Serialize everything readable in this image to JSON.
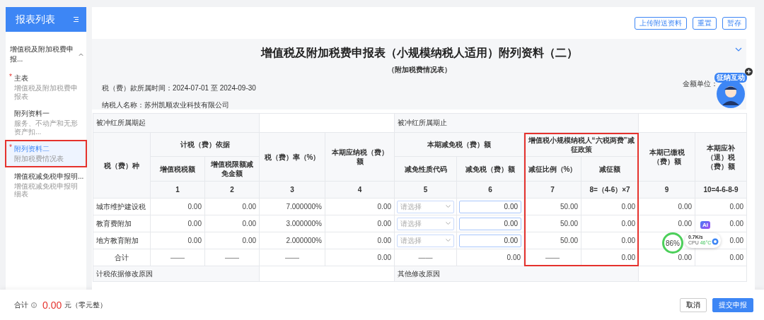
{
  "sidebar": {
    "title": "报表列表",
    "required_mark": "*",
    "group": {
      "label": "增值税及附加税费申报...",
      "expanded": true,
      "items": [
        {
          "title": "主表",
          "subtitle": "增值税及附加税费申报表",
          "required": true,
          "selected": false,
          "outlined": false
        },
        {
          "title": "附列资料一",
          "subtitle": "服务、不动产和无形资产扣...",
          "required": false,
          "selected": false,
          "outlined": false
        },
        {
          "title": "附列资料二",
          "subtitle": "附加税费情况表",
          "required": true,
          "selected": true,
          "outlined": true
        },
        {
          "title": "增值税减免税申报明...",
          "subtitle": "增值税减免税申报明细表",
          "required": false,
          "selected": false,
          "outlined": false
        }
      ]
    }
  },
  "toolbar_buttons": [
    "上传附送资料",
    "重置",
    "暂存"
  ],
  "form": {
    "title": "增值税及附加税费申报表（小规模纳税人适用）附列资料（二）",
    "subtitle": "（附加税费情况表）",
    "period": "税（费）款所属时间：2024-07-01 至 2024-09-30",
    "taxpayer": "纳税人名称：苏州凯顺农业科技有限公司",
    "unit_label": "金额单位：",
    "expanded": true
  },
  "assistant": {
    "label": "征纳互动"
  },
  "table": {
    "period_start": "被冲红所属期起",
    "period_end": "被冲红所属期止",
    "header_row_1": [
      "税（费）种",
      "计税（费）依据",
      "税（费）率（%）",
      "本期应纳税（费）额",
      "本期减免税（费）额",
      "增值税小规模纳税人“六税两费”减征政策",
      "本期已缴税（费）额",
      "本期应补（退）税（费）额"
    ],
    "header_row_2": [
      "增值税税额",
      "增值税限额减免金额",
      "减免性质代码",
      "减免税（费）额",
      "减征比例（%）",
      "减征额"
    ],
    "column_numbers": [
      "1",
      "2",
      "3",
      "4",
      "5",
      "6",
      "7",
      "8=（4-6）×7",
      "9",
      "10=4-6-8-9"
    ],
    "rows": [
      {
        "kind": "data",
        "label": "城市维护建设税",
        "cells": [
          {
            "kind": "text",
            "text": "0.00"
          },
          {
            "kind": "text",
            "text": "0.00"
          },
          {
            "kind": "text",
            "text": "7.000000%"
          },
          {
            "kind": "text",
            "text": "0.00"
          },
          {
            "kind": "select",
            "placeholder": "请选择"
          },
          {
            "kind": "input",
            "value": "0.00"
          },
          {
            "kind": "text",
            "text": "50.00"
          },
          {
            "kind": "text",
            "text": "0.00"
          },
          {
            "kind": "text",
            "text": "0.00"
          },
          {
            "kind": "text",
            "text": "0.00"
          }
        ]
      },
      {
        "kind": "data",
        "label": "教育费附加",
        "cells": [
          {
            "kind": "text",
            "text": "0.00"
          },
          {
            "kind": "text",
            "text": "0.00"
          },
          {
            "kind": "text",
            "text": "3.000000%"
          },
          {
            "kind": "text",
            "text": "0.00"
          },
          {
            "kind": "select",
            "placeholder": "请选择"
          },
          {
            "kind": "input",
            "value": "0.00"
          },
          {
            "kind": "text",
            "text": "50.00"
          },
          {
            "kind": "text",
            "text": "0.00"
          },
          {
            "kind": "text",
            "text": "0.00"
          },
          {
            "kind": "text",
            "text": "0.00"
          }
        ]
      },
      {
        "kind": "data",
        "label": "地方教育附加",
        "cells": [
          {
            "kind": "text",
            "text": "0.00"
          },
          {
            "kind": "text",
            "text": "0.00"
          },
          {
            "kind": "text",
            "text": "2.000000%"
          },
          {
            "kind": "text",
            "text": "0.00"
          },
          {
            "kind": "select",
            "placeholder": "请选择"
          },
          {
            "kind": "input",
            "value": "0.00"
          },
          {
            "kind": "text",
            "text": "50.00"
          },
          {
            "kind": "text",
            "text": "0.00"
          },
          {
            "kind": "blank"
          },
          {
            "kind": "text",
            "text": "0.00"
          }
        ]
      },
      {
        "kind": "total",
        "label": "合计",
        "cells": [
          {
            "kind": "dash",
            "text": "——"
          },
          {
            "kind": "dash",
            "text": "——"
          },
          {
            "kind": "dash",
            "text": "——"
          },
          {
            "kind": "text",
            "text": "0.00"
          },
          {
            "kind": "dash",
            "text": "——"
          },
          {
            "kind": "text",
            "text": "0.00"
          },
          {
            "kind": "dash",
            "text": "——"
          },
          {
            "kind": "text",
            "text": "0.00"
          },
          {
            "kind": "text",
            "text": "0.00"
          },
          {
            "kind": "text",
            "text": "0.00"
          }
        ]
      }
    ],
    "reason_basis": "计税依据修改原因",
    "reason_other": "其他修改原因",
    "policy_outlined": true
  },
  "monitor_widget": {
    "ai_badge": "AI",
    "percent": "86%",
    "speed": "0.7K/s",
    "cpu_label": "CPU",
    "temperature": "46°C"
  },
  "footer": {
    "total_label": "合计",
    "total_amount": "0.00",
    "total_words": "元（零元整）",
    "buttons": [
      {
        "label": "取消",
        "primary": false
      },
      {
        "label": "提交申报",
        "primary": true
      }
    ]
  }
}
